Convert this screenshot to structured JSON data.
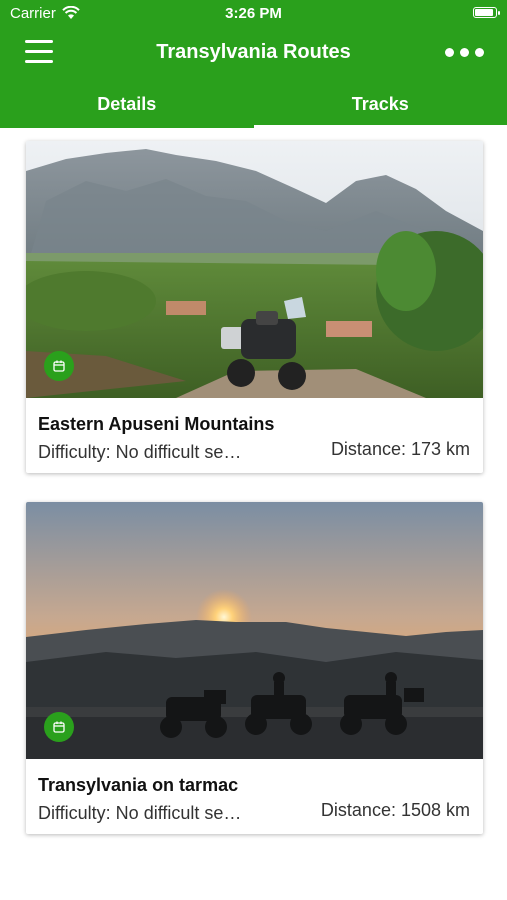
{
  "status": {
    "carrier": "Carrier",
    "time": "3:26 PM"
  },
  "navbar": {
    "title": "Transylvania Routes"
  },
  "tabs": [
    {
      "label": "Details",
      "active": false
    },
    {
      "label": "Tracks",
      "active": true
    }
  ],
  "routes": [
    {
      "name": "Eastern Apuseni Mountains",
      "difficulty": "Difficulty: No difficult se…",
      "distance": "Distance: 173 km",
      "photo": "motorcycle-in-mountain-valley"
    },
    {
      "name": "Transylvania on tarmac",
      "difficulty": "Difficulty: No difficult se…",
      "distance": "Distance: 1508 km",
      "photo": "motorcycles-at-sunset"
    }
  ],
  "colors": {
    "brand": "#2aa01c",
    "text": "#111111",
    "secondary_text": "#333333"
  }
}
